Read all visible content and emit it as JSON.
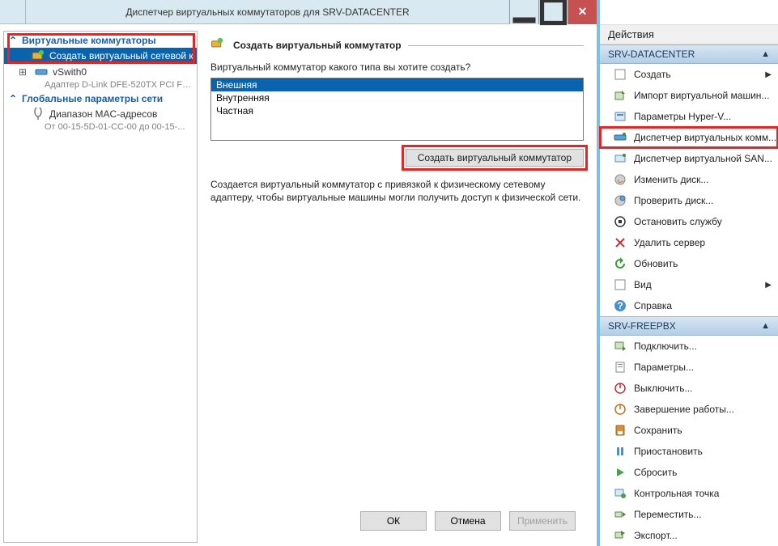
{
  "window": {
    "title": "Диспетчер виртуальных коммутаторов для SRV-DATACENTER"
  },
  "tree": {
    "section1": "Виртуальные коммутаторы",
    "item_new": "Создать виртуальный сетевой к...",
    "item_vswitch": "vSwith0",
    "item_vswitch_sub": "Адаптер D-Link DFE-520TX PCI Fa...",
    "section2": "Глобальные параметры сети",
    "item_mac": "Диапазон MAC-адресов",
    "item_mac_sub": "От 00-15-5D-01-CC-00 до 00-15-..."
  },
  "detail": {
    "header": "Создать виртуальный коммутатор",
    "prompt": "Виртуальный коммутатор какого типа вы хотите создать?",
    "options": [
      "Внешняя",
      "Внутренняя",
      "Частная"
    ],
    "create_btn": "Создать виртуальный коммутатор",
    "description": "Создается виртуальный коммутатор с привязкой к физическому сетевому адаптеру, чтобы виртуальные машины могли получить доступ к физической сети."
  },
  "buttons": {
    "ok": "ОК",
    "cancel": "Отмена",
    "apply": "Применить"
  },
  "actions": {
    "title": "Действия",
    "group1": {
      "header": "SRV-DATACENTER",
      "items": [
        {
          "label": "Создать",
          "arrow": true
        },
        {
          "label": "Импорт виртуальной машин..."
        },
        {
          "label": "Параметры Hyper-V..."
        },
        {
          "label": "Диспетчер виртуальных комм...",
          "hl": true
        },
        {
          "label": "Диспетчер виртуальной SAN..."
        },
        {
          "label": "Изменить диск..."
        },
        {
          "label": "Проверить диск..."
        },
        {
          "label": "Остановить службу"
        },
        {
          "label": "Удалить сервер"
        },
        {
          "label": "Обновить"
        },
        {
          "label": "Вид",
          "arrow": true
        },
        {
          "label": "Справка"
        }
      ]
    },
    "group2": {
      "header": "SRV-FREEPBX",
      "items": [
        {
          "label": "Подключить..."
        },
        {
          "label": "Параметры..."
        },
        {
          "label": "Выключить..."
        },
        {
          "label": "Завершение работы..."
        },
        {
          "label": "Сохранить"
        },
        {
          "label": "Приостановить"
        },
        {
          "label": "Сбросить"
        },
        {
          "label": "Контрольная точка"
        },
        {
          "label": "Переместить..."
        },
        {
          "label": "Экспорт..."
        }
      ]
    }
  }
}
